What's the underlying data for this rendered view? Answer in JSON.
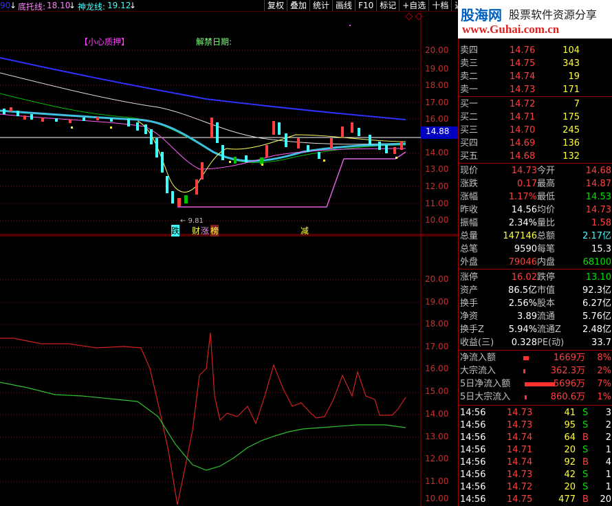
{
  "header": {
    "indicator_prefix": "90",
    "arrow1": "↓",
    "dituo_label": "底托线:",
    "dituo_value": "18.10",
    "arrow2": "↓",
    "shenlong_label": "神龙线:",
    "shenlong_value": "19.12",
    "arrow3": "↓"
  },
  "toolbar": {
    "items": [
      "复权",
      "叠加",
      "统计",
      "画线",
      "F10",
      "标记",
      "+自选",
      "十档",
      "返回"
    ]
  },
  "chart_labels": {
    "caution_tag": "【小心质押】",
    "unlock_label": "解禁日期:",
    "low_mark": "← 9.81",
    "event_tags": [
      "跌",
      "财",
      "涨",
      "榜",
      "减"
    ],
    "current_price_tag": "14.88"
  },
  "upper_axis": [
    "20.00",
    "19.00",
    "18.00",
    "17.00",
    "16.00",
    "15.00",
    "14.00",
    "13.00",
    "12.00",
    "11.00",
    "10.00"
  ],
  "lower_axis": [
    "20.00",
    "19.00",
    "18.00",
    "17.00",
    "16.00",
    "15.00",
    "14.00",
    "13.00",
    "12.00",
    "11.00",
    "10.00"
  ],
  "logo": {
    "brand": "股海网",
    "slogan": "股票软件资源分享",
    "url": "www.Guhai.com.cn"
  },
  "quote": {
    "ask": [
      {
        "label": "卖四",
        "price": "14.76",
        "vol": "104"
      },
      {
        "label": "卖三",
        "price": "14.75",
        "vol": "343"
      },
      {
        "label": "卖二",
        "price": "14.74",
        "vol": "19"
      },
      {
        "label": "卖一",
        "price": "14.73",
        "vol": "171"
      }
    ],
    "bid": [
      {
        "label": "买一",
        "price": "14.72",
        "vol": "7"
      },
      {
        "label": "买二",
        "price": "14.71",
        "vol": "175"
      },
      {
        "label": "买三",
        "price": "14.70",
        "vol": "245"
      },
      {
        "label": "买四",
        "price": "14.69",
        "vol": "136"
      },
      {
        "label": "买五",
        "price": "14.68",
        "vol": "132"
      }
    ],
    "stats": [
      {
        "l1": "现价",
        "v1": "14.73",
        "c1": "red",
        "l2": "今开",
        "v2": "14.68",
        "c2": "red"
      },
      {
        "l1": "涨跌",
        "v1": "0.17",
        "c1": "red",
        "l2": "最高",
        "v2": "14.87",
        "c2": "red"
      },
      {
        "l1": "涨幅",
        "v1": "1.17%",
        "c1": "red",
        "l2": "最低",
        "v2": "14.53",
        "c2": "green"
      },
      {
        "l1": "昨收",
        "v1": "14.56",
        "c1": "white",
        "l2": "均价",
        "v2": "14.73",
        "c2": "red"
      },
      {
        "l1": "振幅",
        "v1": "2.34%",
        "c1": "white",
        "l2": "量比",
        "v2": "1.58",
        "c2": "red"
      },
      {
        "l1": "总量",
        "v1": "147146",
        "c1": "yellow",
        "l2": "总额",
        "v2": "2.17亿",
        "c2": "cyan"
      },
      {
        "l1": "总笔",
        "v1": "9590",
        "c1": "white",
        "l2": "每笔",
        "v2": "15.3",
        "c2": "white"
      },
      {
        "l1": "外盘",
        "v1": "79046",
        "c1": "red",
        "l2": "内盘",
        "v2": "68100",
        "c2": "green"
      }
    ],
    "fund": [
      {
        "l1": "涨停",
        "v1": "16.02",
        "c1": "red",
        "l2": "跌停",
        "v2": "13.10",
        "c2": "green"
      },
      {
        "l1": "资产",
        "v1": "86.5亿",
        "c1": "white",
        "l2": "市值",
        "v2": "92.3亿",
        "c2": "white"
      },
      {
        "l1": "换手",
        "v1": "2.56%",
        "c1": "white",
        "l2": "股本",
        "v2": "6.27亿",
        "c2": "white"
      },
      {
        "l1": "净资",
        "v1": "3.89",
        "c1": "white",
        "l2": "流通",
        "v2": "5.76亿",
        "c2": "white"
      },
      {
        "l1": "换手Z",
        "v1": "5.94%",
        "c1": "white",
        "l2": "流通Z",
        "v2": "2.48亿",
        "c2": "white"
      },
      {
        "l1": "收益(三)",
        "v1": "0.328",
        "c1": "white",
        "l2": "PE(动)",
        "v2": "33.7",
        "c2": "white"
      }
    ],
    "flow": [
      {
        "label": "净流入额",
        "bar": 0.15,
        "value": "1669万",
        "pct": "8%"
      },
      {
        "label": "大宗流入",
        "bar": 0.05,
        "value": "362.3万",
        "pct": "2%"
      },
      {
        "label": "5日净流入额",
        "bar": 1.0,
        "value": "5696万",
        "pct": "7%"
      },
      {
        "label": "5日大宗流入",
        "bar": 0.05,
        "value": "860.6万",
        "pct": "1%"
      }
    ],
    "ticks": [
      {
        "time": "14:56",
        "price": "14.73",
        "vol": "41",
        "side": "S",
        "n": "3"
      },
      {
        "time": "14:56",
        "price": "14.73",
        "vol": "95",
        "side": "S",
        "n": "2"
      },
      {
        "time": "14:56",
        "price": "14.74",
        "vol": "64",
        "side": "B",
        "n": "2"
      },
      {
        "time": "14:56",
        "price": "14.71",
        "vol": "20",
        "side": "S",
        "n": "1"
      },
      {
        "time": "14:56",
        "price": "14.74",
        "vol": "92",
        "side": "B",
        "n": "4"
      },
      {
        "time": "14:56",
        "price": "14.73",
        "vol": "42",
        "side": "S",
        "n": "1"
      },
      {
        "time": "14:56",
        "price": "14.72",
        "vol": "20",
        "side": "S",
        "n": "1"
      },
      {
        "time": "14:56",
        "price": "14.75",
        "vol": "477",
        "side": "B",
        "n": "20"
      }
    ]
  },
  "colors": {
    "frame": "#a00000",
    "up": "#ff4040",
    "down": "#40ffff",
    "ma_blue": "#3030ff"
  }
}
